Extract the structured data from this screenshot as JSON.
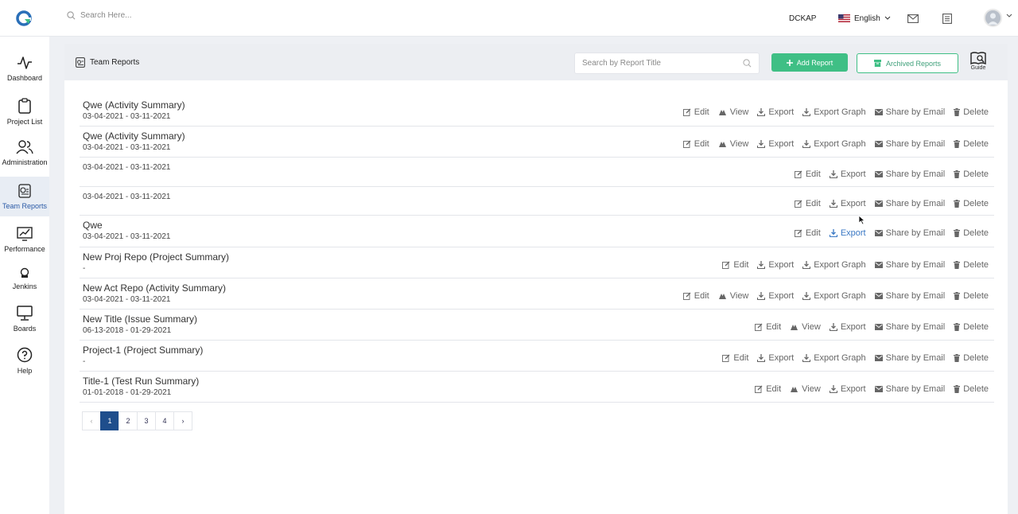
{
  "topbar": {
    "search_placeholder": "Search Here...",
    "org": "DCKAP",
    "language": "English"
  },
  "sidebar": {
    "items": [
      {
        "label": "Dashboard"
      },
      {
        "label": "Project List"
      },
      {
        "label": "Administration"
      },
      {
        "label": "Team Reports"
      },
      {
        "label": "Performance"
      },
      {
        "label": "Jenkins"
      },
      {
        "label": "Boards"
      },
      {
        "label": "Help"
      }
    ]
  },
  "panel": {
    "title": "Team Reports",
    "search_placeholder": "Search by Report Title",
    "add_label": "Add Report",
    "archived_label": "Archived Reports",
    "guide_label": "Guide"
  },
  "actions_labels": {
    "edit": "Edit",
    "view": "View",
    "export": "Export",
    "export_graph": "Export Graph",
    "share": "Share by Email",
    "delete": "Delete"
  },
  "reports": [
    {
      "title": "Qwe (Activity Summary)",
      "date": "03-04-2021 - 03-11-2021"
    },
    {
      "title": "Qwe (Activity Summary)",
      "date": "03-04-2021 - 03-11-2021"
    },
    {
      "title": "",
      "date": "03-04-2021 - 03-11-2021"
    },
    {
      "title": "",
      "date": "03-04-2021 - 03-11-2021"
    },
    {
      "title": "Qwe",
      "date": "03-04-2021 - 03-11-2021"
    },
    {
      "title": "New Proj Repo (Project Summary)",
      "date": "-"
    },
    {
      "title": "New Act Repo (Activity Summary)",
      "date": "03-04-2021 - 03-11-2021"
    },
    {
      "title": "New Title (Issue Summary)",
      "date": "06-13-2018 - 01-29-2021"
    },
    {
      "title": "Project-1 (Project Summary)",
      "date": "-"
    },
    {
      "title": "Title-1 (Test Run Summary)",
      "date": "01-01-2018 - 01-29-2021"
    }
  ],
  "pagination": {
    "prev": "‹",
    "pages": [
      "1",
      "2",
      "3",
      "4"
    ],
    "next": "›",
    "current": "1"
  },
  "colors": {
    "accent_green": "#3fbf85",
    "active_page": "#1f4e8c",
    "link_hover": "#3a78c4"
  }
}
